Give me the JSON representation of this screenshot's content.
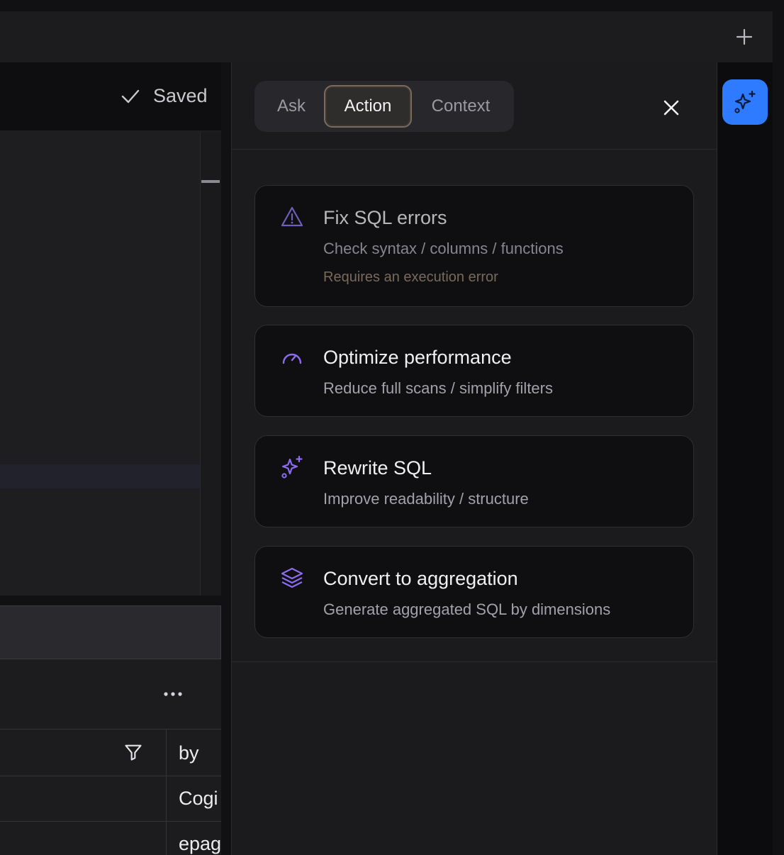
{
  "editor": {
    "saved_label": "Saved"
  },
  "results": {
    "column_header": "by",
    "rows": [
      "Cogi",
      "epag"
    ]
  },
  "ai_panel": {
    "tabs": [
      {
        "label": "Ask",
        "active": false
      },
      {
        "label": "Action",
        "active": true
      },
      {
        "label": "Context",
        "active": false
      }
    ],
    "actions": [
      {
        "icon": "warning-triangle-icon",
        "title": "Fix SQL errors",
        "subtitle": "Check syntax / columns / functions",
        "note": "Requires an execution error",
        "enabled": false
      },
      {
        "icon": "speedometer-icon",
        "title": "Optimize performance",
        "subtitle": "Reduce full scans / simplify filters",
        "enabled": true
      },
      {
        "icon": "sparkles-icon",
        "title": "Rewrite SQL",
        "subtitle": "Improve readability / structure",
        "enabled": true
      },
      {
        "icon": "layers-icon",
        "title": "Convert to aggregation",
        "subtitle": "Generate aggregated SQL by dimensions",
        "enabled": true
      }
    ]
  },
  "colors": {
    "accent": "#2f7bff",
    "icon_purple": "#8b6cf0",
    "note_brown": "#786a5a"
  }
}
